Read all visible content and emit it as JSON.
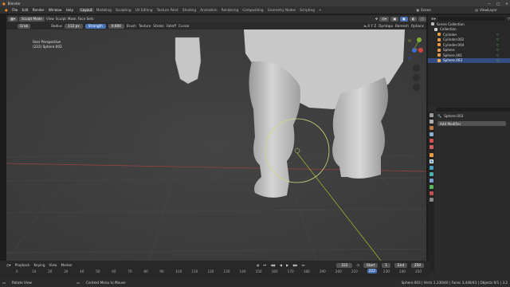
{
  "app": {
    "title": "Blender"
  },
  "window_controls": [
    "—",
    "□",
    "✕"
  ],
  "menu": [
    "File",
    "Edit",
    "Render",
    "Window",
    "Help"
  ],
  "workspaces": [
    {
      "label": "Layout",
      "active": true
    },
    {
      "label": "Modeling",
      "active": false
    },
    {
      "label": "Sculpting",
      "active": false
    },
    {
      "label": "UV Editing",
      "active": false
    },
    {
      "label": "Texture Paint",
      "active": false
    },
    {
      "label": "Shading",
      "active": false
    },
    {
      "label": "Animation",
      "active": false
    },
    {
      "label": "Rendering",
      "active": false
    },
    {
      "label": "Compositing",
      "active": false
    },
    {
      "label": "Geometry Nodes",
      "active": false
    },
    {
      "label": "Scripting",
      "active": false
    }
  ],
  "scene": {
    "scene_name": "Scene",
    "view_layer": "ViewLayer"
  },
  "editor_header": {
    "mode": "Sculpt Mode",
    "view": "View",
    "sculpt": "Sculpt",
    "mask": "Mask",
    "face_sets": "Face Sets"
  },
  "tool_settings": {
    "tool_name": "Grab",
    "radius_label": "Radius",
    "radius_value": "112 px",
    "strength_label": "Strength",
    "strength_value": "0.600",
    "brush": "Brush",
    "texture": "Texture",
    "stroke": "Stroke",
    "falloff": "Falloff",
    "cursor": "Cursor",
    "symmetry": "Dyntopo",
    "remesh": "Remesh",
    "options": "Options"
  },
  "viewport": {
    "view_name": "User Perspective",
    "object_info": "(222) Sphere.003"
  },
  "outliner": {
    "collection_label": "Scene Collection",
    "items": [
      {
        "label": "Collection",
        "level": 1,
        "selected": false
      },
      {
        "label": "Cylinder",
        "level": 2,
        "selected": false
      },
      {
        "label": "Cylinder.002",
        "level": 2,
        "selected": false
      },
      {
        "label": "Cylinder.004",
        "level": 2,
        "selected": false
      },
      {
        "label": "Sphere",
        "level": 2,
        "selected": false
      },
      {
        "label": "Sphere.001",
        "level": 2,
        "selected": false
      },
      {
        "label": "Sphere.003",
        "level": 2,
        "selected": true
      }
    ]
  },
  "properties": {
    "object_name": "Sphere.003",
    "add_modifier": "Add Modifier"
  },
  "timeline": {
    "playback": "Playback",
    "keying": "Keying",
    "view": "View",
    "marker": "Marker",
    "current_frame": "222",
    "start_label": "Start",
    "start_value": "1",
    "end_label": "End",
    "end_value": "250",
    "ticks": [
      "0",
      "10",
      "20",
      "30",
      "40",
      "50",
      "60",
      "70",
      "80",
      "90",
      "100",
      "110",
      "120",
      "130",
      "140",
      "150",
      "160",
      "170",
      "180",
      "190",
      "200",
      "210",
      "220",
      "230",
      "240",
      "250"
    ]
  },
  "status": {
    "left_hint": "Rotate View",
    "center_hint": "Context Menu to Mouse",
    "right_info": "Sphere.003 | Verts 1,330/40 | Faces 3,446/43 | Objects 0/1 | 3.2"
  },
  "colors": {
    "accent": "#4772b3",
    "selected_row": "#334d80",
    "brush_circle": "#d8d880",
    "x_axis": "#a04040",
    "y_axis": "#9fc030"
  }
}
